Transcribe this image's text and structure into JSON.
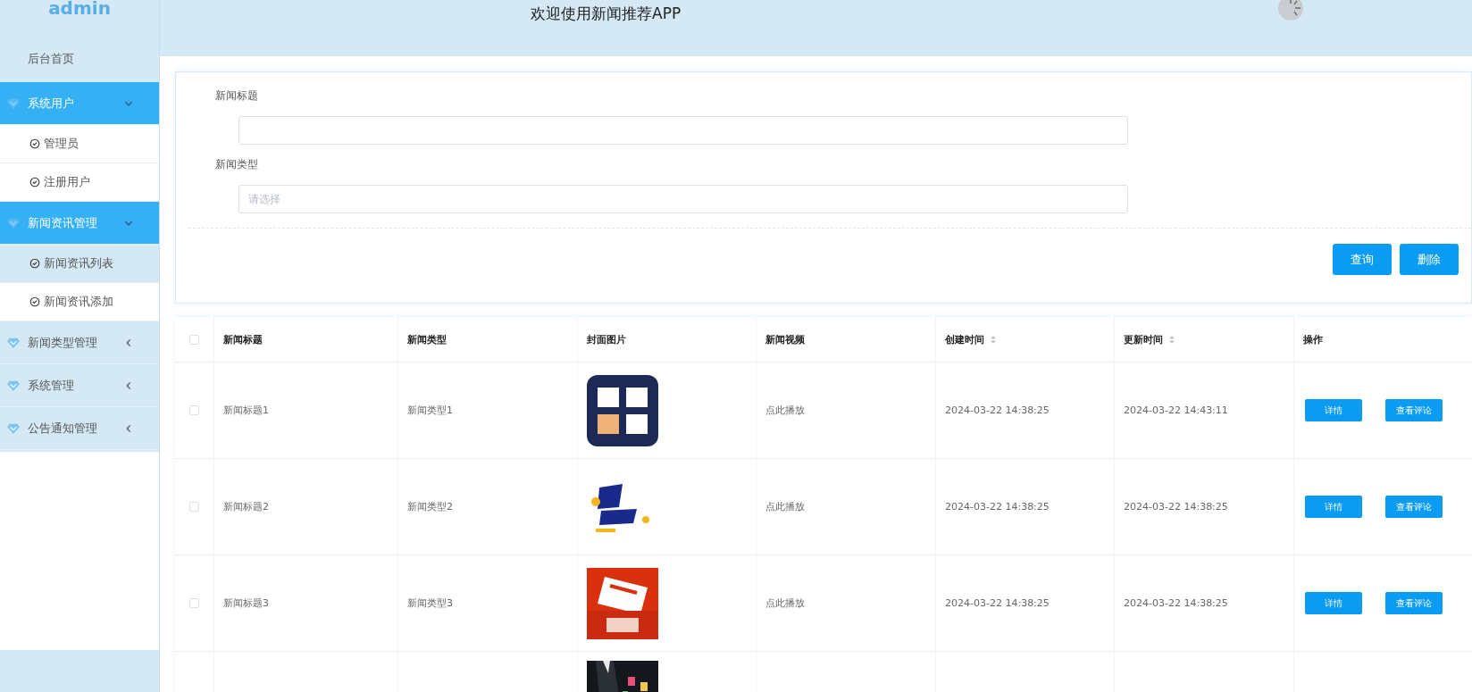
{
  "sidebar": {
    "brand": "admin",
    "home": "后台首页",
    "groups": [
      {
        "label": "系统用户",
        "expanded": true,
        "children": [
          {
            "label": "管理员",
            "selected": false
          },
          {
            "label": "注册用户",
            "selected": false
          }
        ]
      },
      {
        "label": "新闻资讯管理",
        "expanded": true,
        "children": [
          {
            "label": "新闻资讯列表",
            "selected": true
          },
          {
            "label": "新闻资讯添加",
            "selected": false
          }
        ]
      },
      {
        "label": "新闻类型管理",
        "expanded": false
      },
      {
        "label": "系统管理",
        "expanded": false
      },
      {
        "label": "公告通知管理",
        "expanded": false
      }
    ]
  },
  "header": {
    "title": "欢迎使用新闻推荐APP"
  },
  "search_form": {
    "fields": [
      {
        "label": "新闻标题",
        "kind": "input"
      },
      {
        "label": "新闻类型",
        "kind": "select",
        "placeholder": "请选择"
      }
    ],
    "buttons": [
      "查询",
      "删除"
    ]
  },
  "table": {
    "select_all": {
      "checked": false
    },
    "columns": [
      {
        "label": "新闻标题",
        "sortable": false
      },
      {
        "label": "新闻类型",
        "sortable": false
      },
      {
        "label": "封面图片",
        "sortable": false
      },
      {
        "label": "新闻视频",
        "sortable": false
      },
      {
        "label": "创建时间",
        "sortable": true
      },
      {
        "label": "更新时间",
        "sortable": true
      },
      {
        "label": "操作",
        "sortable": false
      }
    ],
    "rows": [
      {
        "checked": false,
        "title": "新闻标题1",
        "type": "新闻类型1",
        "cover": {
          "kind": "picture"
        },
        "video": "点此播放",
        "created": "2024-03-22 14:38:25",
        "updated": "2024-03-22 14:43:11",
        "actions": [
          "详情",
          "查看评论"
        ]
      },
      {
        "checked": false,
        "title": "新闻标题2",
        "type": "新闻类型2",
        "cover": {
          "kind": "picture"
        },
        "video": "点此播放",
        "created": "2024-03-22 14:38:25",
        "updated": "2024-03-22 14:38:25",
        "actions": [
          "详情",
          "查看评论"
        ]
      },
      {
        "checked": false,
        "title": "新闻标题3",
        "type": "新闻类型3",
        "cover": {
          "kind": "picture"
        },
        "video": "点此播放",
        "created": "2024-03-22 14:38:25",
        "updated": "2024-03-22 14:38:25",
        "actions": [
          "详情",
          "查看评论"
        ]
      }
    ],
    "cut_off_row": {
      "cover": {
        "kind": "picture"
      }
    }
  }
}
